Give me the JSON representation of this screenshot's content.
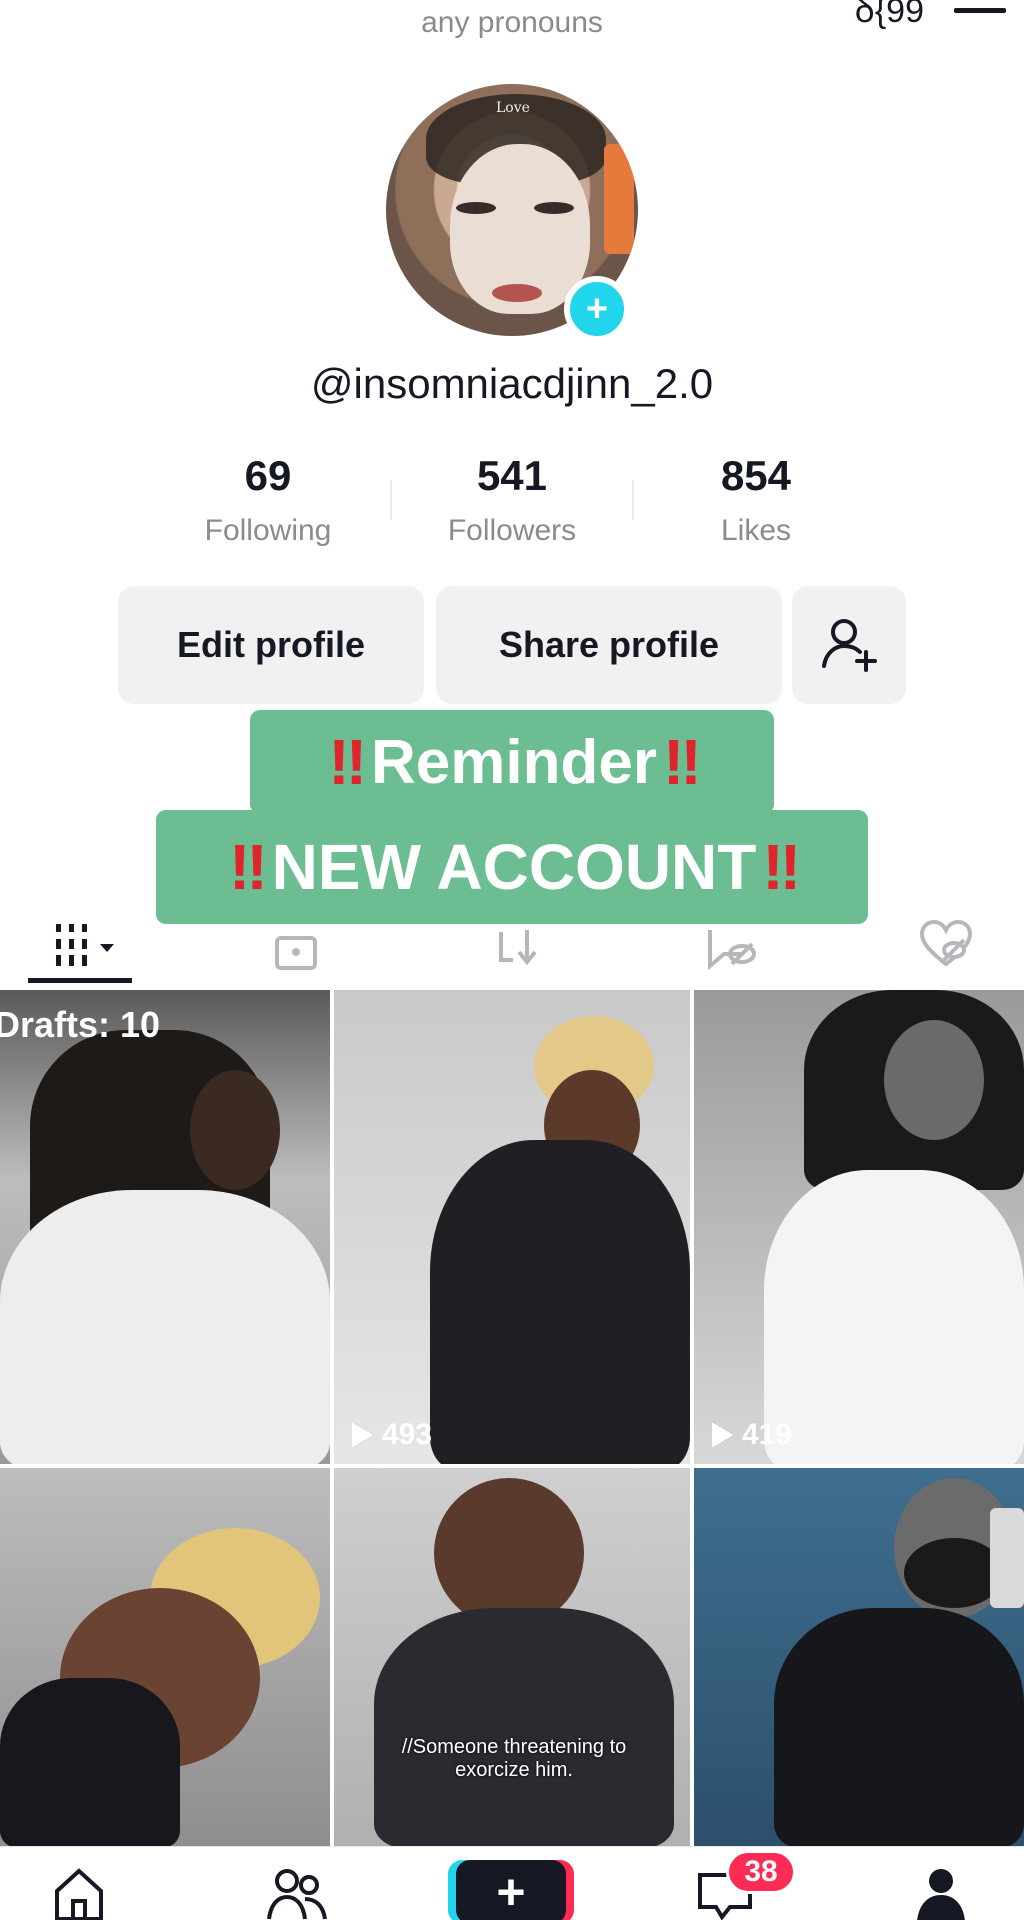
{
  "header": {
    "pronouns": "any pronouns",
    "corner_text": "ꝺ{99"
  },
  "profile": {
    "avatar_overlay_text": "Love",
    "username": "@insomniacdjinn_2.0"
  },
  "stats": [
    {
      "value": "69",
      "label": "Following"
    },
    {
      "value": "541",
      "label": "Followers"
    },
    {
      "value": "854",
      "label": "Likes"
    }
  ],
  "actions": {
    "edit_profile": "Edit profile",
    "share_profile": "Share profile"
  },
  "overlay": {
    "line1_marks_left": "‼",
    "line1_text": "Reminder",
    "line1_marks_right": "‼",
    "line2_marks_left": "‼",
    "line2_text": "NEW ACCOUNT",
    "line2_marks_right": "‼"
  },
  "tabs": [
    {
      "icon": "videos-grid-icon",
      "active": true
    },
    {
      "icon": "private-lock-icon",
      "active": false
    },
    {
      "icon": "reposts-icon",
      "active": false
    },
    {
      "icon": "hidden-icon",
      "active": false
    },
    {
      "icon": "liked-hidden-icon",
      "active": false
    }
  ],
  "grid": {
    "drafts_label": "Drafts: 10",
    "videos": [
      {
        "views": ""
      },
      {
        "views": "493"
      },
      {
        "views": "419"
      },
      {
        "views": ""
      },
      {
        "views": "",
        "caption": "//Someone threatening to exorcize him."
      },
      {
        "views": ""
      }
    ]
  },
  "nav": {
    "inbox_badge": "38"
  },
  "colors": {
    "accent_cyan": "#20d5ec",
    "accent_red": "#fe2c55",
    "banner_green": "#6cbd91"
  }
}
